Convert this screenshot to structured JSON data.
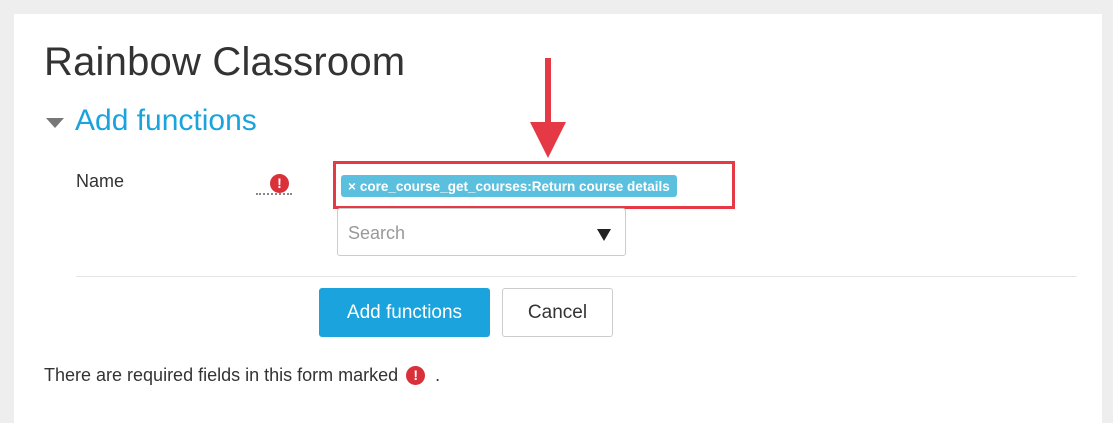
{
  "page": {
    "title": "Rainbow Classroom"
  },
  "section": {
    "title": "Add functions"
  },
  "form": {
    "name_label": "Name",
    "required_icon": "!",
    "selected_chip": {
      "remove_symbol": "×",
      "label": "core_course_get_courses:Return course details"
    },
    "search": {
      "placeholder": "Search"
    },
    "buttons": {
      "submit": "Add functions",
      "cancel": "Cancel"
    }
  },
  "footer": {
    "note_prefix": "There are required fields in this form marked",
    "note_suffix": "."
  },
  "colors": {
    "accent": "#1aa3dc",
    "chip": "#5bc0de",
    "required": "#d9303a",
    "annotation": "#e63946"
  },
  "icons": [
    "caret-down-icon",
    "required-icon",
    "dropdown-arrow-icon",
    "annotation-arrow-icon"
  ]
}
